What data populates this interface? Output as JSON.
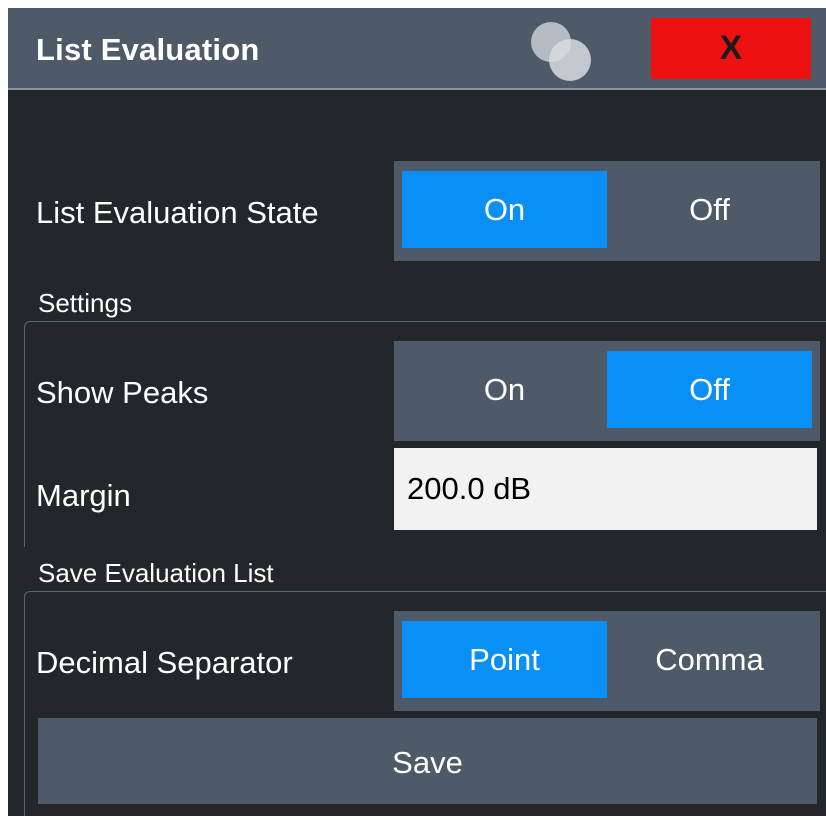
{
  "dialog": {
    "title": "List Evaluation",
    "close_label": "X",
    "logo_icon": "rs-logo-icon",
    "close_icon": "close-icon"
  },
  "list_evaluation_state": {
    "label": "List Evaluation State",
    "on_label": "On",
    "off_label": "Off",
    "selected": "On"
  },
  "settings": {
    "section_label": "Settings",
    "show_peaks": {
      "label": "Show Peaks",
      "on_label": "On",
      "off_label": "Off",
      "selected": "Off"
    },
    "margin": {
      "label": "Margin",
      "value": "200.0 dB"
    }
  },
  "save_evaluation_list": {
    "section_label": "Save Evaluation List",
    "decimal_separator": {
      "label": "Decimal Separator",
      "point_label": "Point",
      "comma_label": "Comma",
      "selected": "Point"
    },
    "save_label": "Save"
  },
  "colors": {
    "background": "#23272c",
    "titlebar": "#4e5a67",
    "active": "#0a8ff7",
    "close": "#ee1111",
    "input": "#f2f2f2"
  }
}
